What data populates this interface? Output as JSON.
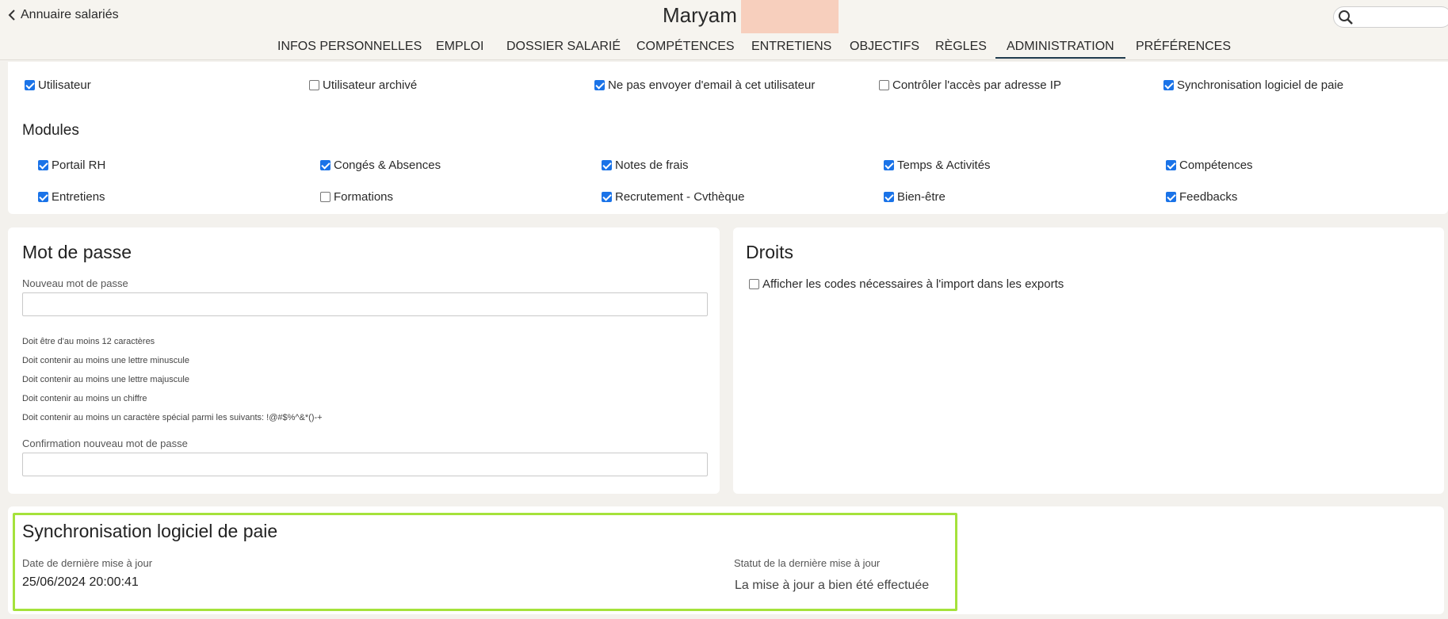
{
  "header": {
    "back_label": "Annuaire salariés",
    "employee_name": "Maryam",
    "search_placeholder": ""
  },
  "tabs": [
    {
      "label": "INFOS PERSONNELLES",
      "active": false
    },
    {
      "label": "EMPLOI",
      "active": false
    },
    {
      "label": "DOSSIER SALARIÉ",
      "active": false
    },
    {
      "label": "COMPÉTENCES",
      "active": false
    },
    {
      "label": "ENTRETIENS",
      "active": false
    },
    {
      "label": "OBJECTIFS",
      "active": false
    },
    {
      "label": "RÈGLES",
      "active": false
    },
    {
      "label": "ADMINISTRATION",
      "active": true
    },
    {
      "label": "PRÉFÉRENCES",
      "active": false
    }
  ],
  "account_options": [
    {
      "label": "Utilisateur",
      "checked": true
    },
    {
      "label": "Utilisateur archivé",
      "checked": false
    },
    {
      "label": "Ne pas envoyer d'email à cet utilisateur",
      "checked": true
    },
    {
      "label": "Contrôler l'accès par adresse IP",
      "checked": false
    },
    {
      "label": "Synchronisation logiciel de paie",
      "checked": true
    }
  ],
  "modules": {
    "title": "Modules",
    "items": [
      {
        "label": "Portail RH",
        "checked": true
      },
      {
        "label": "Congés & Absences",
        "checked": true
      },
      {
        "label": "Notes de frais",
        "checked": true
      },
      {
        "label": "Temps & Activités",
        "checked": true
      },
      {
        "label": "Compétences",
        "checked": true
      },
      {
        "label": "Entretiens",
        "checked": true
      },
      {
        "label": "Formations",
        "checked": false
      },
      {
        "label": "Recrutement - Cvthèque",
        "checked": true
      },
      {
        "label": "Bien-être",
        "checked": true
      },
      {
        "label": "Feedbacks",
        "checked": true
      }
    ]
  },
  "password": {
    "title": "Mot de passe",
    "new_label": "Nouveau mot de passe",
    "new_value": "",
    "rules": [
      "Doit être d'au moins 12 caractères",
      "Doit contenir au moins une lettre minuscule",
      "Doit contenir au moins une lettre majuscule",
      "Doit contenir au moins un chiffre",
      "Doit contenir au moins un caractère spécial parmi les suivants: !@#$%^&*()-+"
    ],
    "confirm_label": "Confirmation nouveau mot de passe",
    "confirm_value": ""
  },
  "rights": {
    "title": "Droits",
    "option": {
      "label": "Afficher les codes nécessaires à l'import dans les exports",
      "checked": false
    }
  },
  "payroll_sync": {
    "title": "Synchronisation logiciel de paie",
    "date_label": "Date de dernière mise à jour",
    "date_value": "25/06/2024 20:00:41",
    "status_label": "Statut de la dernière mise à jour",
    "status_value": "La mise à jour a bien été effectuée"
  },
  "colors": {
    "accent": "#1a73e8",
    "tab_underline": "#1e3a4c",
    "highlight": "#a5e23b"
  }
}
